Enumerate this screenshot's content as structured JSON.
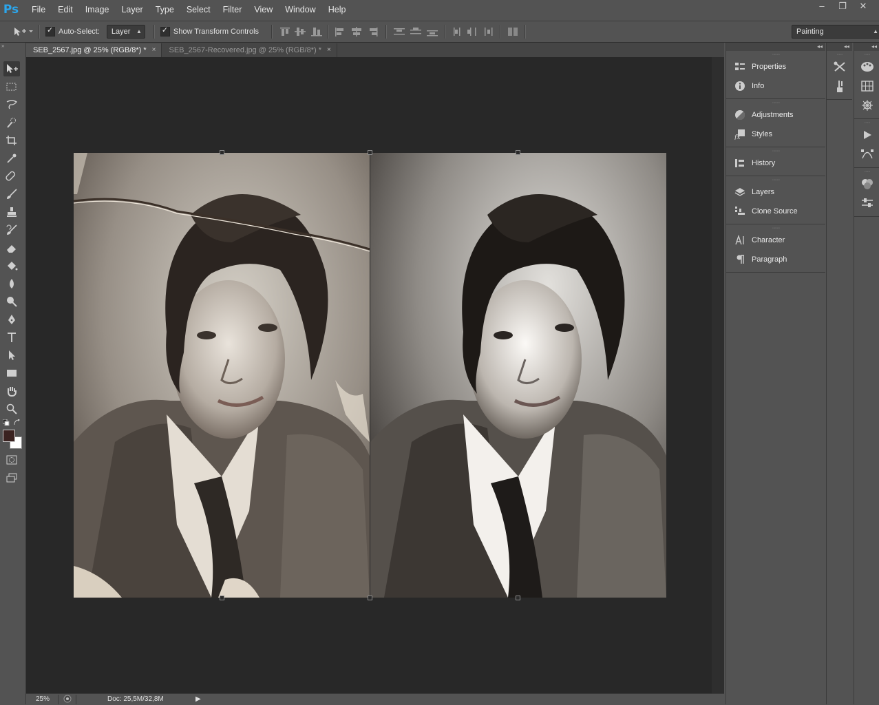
{
  "app": {
    "logo": "Ps"
  },
  "menu": [
    "File",
    "Edit",
    "Image",
    "Layer",
    "Type",
    "Select",
    "Filter",
    "View",
    "Window",
    "Help"
  ],
  "window_controls": {
    "minimize": "–",
    "restore": "❐",
    "close": "✕"
  },
  "options": {
    "auto_select_label": "Auto-Select:",
    "auto_select_value": "Layer",
    "show_transform_label": "Show Transform Controls",
    "workspace": "Painting"
  },
  "tabs": [
    {
      "label": "SEB_2567.jpg @ 25% (RGB/8*) *",
      "active": true
    },
    {
      "label": "SEB_2567-Recovered.jpg @ 25% (RGB/8*) *",
      "active": false
    }
  ],
  "tab_close": "×",
  "status": {
    "zoom": "25%",
    "doc": "Doc: 25,5M/32,8M"
  },
  "panels": [
    [
      "Properties",
      "Info"
    ],
    [
      "Adjustments",
      "Styles"
    ],
    [
      "History"
    ],
    [
      "Layers",
      "Clone Source"
    ],
    [
      "Character",
      "Paragraph"
    ]
  ],
  "colors": {
    "chrome": "#535353",
    "canvas": "#282828",
    "accent": "#2ca6ec",
    "foreground_swatch": "#3a2220",
    "background_swatch": "#ffffff"
  }
}
